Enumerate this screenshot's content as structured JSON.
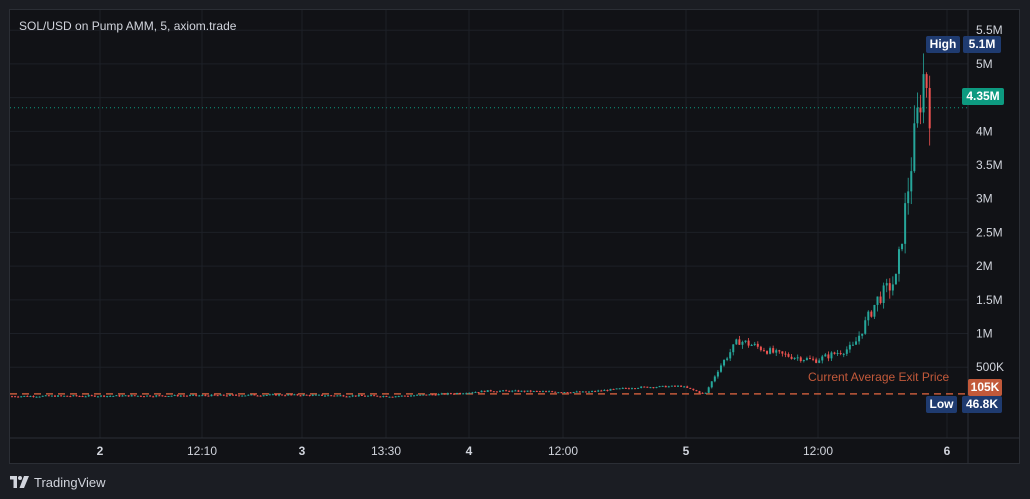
{
  "chart_title": "SOL/USD on Pump AMM, 5, axiom.trade",
  "footer": {
    "brand": "TradingView"
  },
  "colors": {
    "up": "#26a69a",
    "down": "#ef5350",
    "exit_line": "#c2593a",
    "last_price": "#0d9a80",
    "tag": "#1f3b70"
  },
  "chart_data": {
    "type": "candlestick",
    "title": "SOL/USD on Pump AMM, 5, axiom.trade",
    "y_axis": {
      "ticks": [
        "500K",
        "1M",
        "1.5M",
        "2M",
        "2.5M",
        "3M",
        "3.5M",
        "4M",
        "4.5M",
        "5M",
        "5.5M"
      ],
      "tick_values": [
        500000,
        1000000,
        1500000,
        2000000,
        2500000,
        3000000,
        3500000,
        4000000,
        4500000,
        5000000,
        5500000
      ],
      "ylim": [
        -550000,
        5800000
      ]
    },
    "x_axis": {
      "ticks": [
        "2",
        "12:10",
        "3",
        "13:30",
        "4",
        "12:00",
        "5",
        "12:00",
        "6"
      ],
      "bold": [
        true,
        false,
        true,
        false,
        true,
        false,
        true,
        false,
        true
      ]
    },
    "grid": true,
    "high": {
      "tag": "High",
      "label": "5.1M",
      "value": 5100000
    },
    "low": {
      "tag": "Low",
      "label": "46.8K",
      "value": 46800
    },
    "last_price": {
      "label": "4.35M",
      "value": 4350000
    },
    "exit_price": {
      "name": "Current Average Exit Price",
      "label": "105K",
      "value": 105000
    },
    "price_path": [
      [
        0.0,
        70000
      ],
      [
        0.1,
        75000
      ],
      [
        0.2,
        80000
      ],
      [
        0.28,
        90000
      ],
      [
        0.4,
        70000
      ],
      [
        0.45,
        100000
      ],
      [
        0.5,
        150000
      ],
      [
        0.6,
        130000
      ],
      [
        0.65,
        200000
      ],
      [
        0.7,
        220000
      ],
      [
        0.725,
        100000
      ],
      [
        0.74,
        500000
      ],
      [
        0.76,
        900000
      ],
      [
        0.8,
        700000
      ],
      [
        0.84,
        600000
      ],
      [
        0.88,
        800000
      ],
      [
        0.905,
        1500000
      ],
      [
        0.925,
        1800000
      ],
      [
        0.945,
        4000000
      ],
      [
        0.955,
        4950000
      ],
      [
        0.96,
        4350000
      ]
    ]
  }
}
